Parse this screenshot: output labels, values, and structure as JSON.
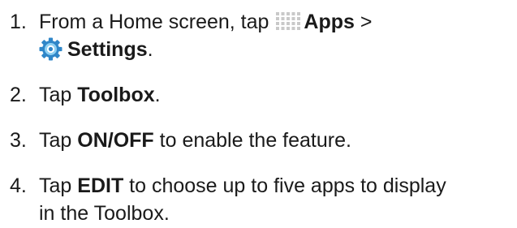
{
  "steps": [
    {
      "number": "1.",
      "line1_prefix": "From a Home screen, tap ",
      "apps_label": "Apps",
      "line1_suffix": " >",
      "settings_label": "Settings",
      "line2_suffix": "."
    },
    {
      "number": "2.",
      "prefix": "Tap ",
      "bold": "Toolbox",
      "suffix": "."
    },
    {
      "number": "3.",
      "prefix": "Tap ",
      "bold": "ON/OFF",
      "suffix": " to enable the feature."
    },
    {
      "number": "4.",
      "prefix": "Tap ",
      "bold": "EDIT",
      "suffix": " to choose up to five apps to display",
      "line2": "in the Toolbox."
    }
  ],
  "icons": {
    "apps": "apps-grid-icon",
    "settings": "settings-gear-icon"
  },
  "colors": {
    "apps_icon": "#c9c9c9",
    "settings_icon_outer": "#2f86c8",
    "settings_icon_inner": "#8fd1f3"
  }
}
